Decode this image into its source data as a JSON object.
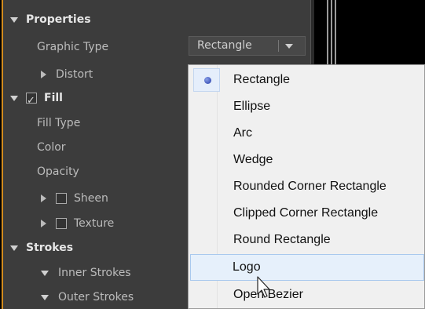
{
  "properties": {
    "header": "Properties",
    "graphic_type_label": "Graphic Type",
    "graphic_type_value": "Rectangle",
    "distort_label": "Distort"
  },
  "fill": {
    "header": "Fill",
    "fill_type_label": "Fill Type",
    "color_label": "Color",
    "opacity_label": "Opacity",
    "sheen_label": "Sheen",
    "texture_label": "Texture"
  },
  "strokes": {
    "header": "Strokes",
    "inner_label": "Inner Strokes",
    "outer_label": "Outer Strokes"
  },
  "menu": {
    "items": [
      {
        "label": "Rectangle",
        "checked": true
      },
      {
        "label": "Ellipse"
      },
      {
        "label": "Arc"
      },
      {
        "label": "Wedge"
      },
      {
        "label": "Rounded Corner Rectangle"
      },
      {
        "label": "Clipped Corner Rectangle"
      },
      {
        "label": "Round Rectangle"
      },
      {
        "label": "Logo",
        "hovered": true
      },
      {
        "label": "Open Bezier"
      }
    ]
  },
  "colors": {
    "panel_bg": "#3c3c3c",
    "accent_border": "#d18a1c",
    "menu_bg": "#f0f0f0",
    "hover_bg": "#e6f0fb",
    "radio_color": "#2a44b0"
  }
}
